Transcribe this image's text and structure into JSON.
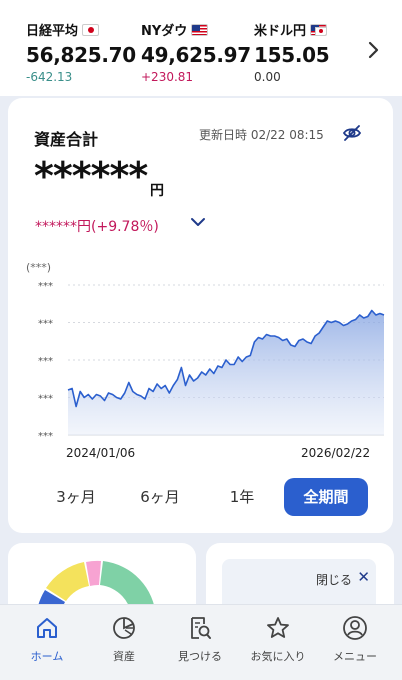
{
  "ticker": [
    {
      "name": "日経平均",
      "value": "56,825.70",
      "change": "-642.13",
      "change_color": "#3a8f8a",
      "flag": "jp"
    },
    {
      "name": "NYダウ",
      "value": "49,625.97",
      "change": "+230.81",
      "change_color": "#c2185b",
      "flag": "us"
    },
    {
      "name": "米ドル円",
      "value": "155.05",
      "change": "0.00",
      "change_color": "#333333",
      "flag": "usjp"
    }
  ],
  "assets": {
    "title": "資産合計",
    "updated": "更新日時 02/22 08:15",
    "total_masked": "******",
    "total_unit": "円",
    "pnl": "******円(+9.78％)",
    "pnl_color": "#c2185b"
  },
  "chart": {
    "unit_label": "(***)",
    "tick_labels": [
      "***",
      "***",
      "***",
      "***",
      "***"
    ],
    "date_start": "2024/01/06",
    "date_end": "2026/02/22",
    "line_color": "#2b5fce"
  },
  "chart_data": {
    "type": "area",
    "x_range": [
      "2024/01/06",
      "2026/02/22"
    ],
    "y_hidden": true,
    "series": [
      {
        "values": [
          0.3,
          0.31,
          0.19,
          0.29,
          0.25,
          0.27,
          0.24,
          0.27,
          0.26,
          0.23,
          0.28,
          0.27,
          0.25,
          0.24,
          0.28,
          0.35,
          0.29,
          0.27,
          0.26,
          0.24,
          0.31,
          0.29,
          0.34,
          0.31,
          0.33,
          0.28,
          0.33,
          0.37,
          0.45,
          0.33,
          0.4,
          0.36,
          0.38,
          0.42,
          0.4,
          0.44,
          0.41,
          0.46,
          0.45,
          0.5,
          0.47,
          0.47,
          0.52,
          0.49,
          0.52,
          0.53,
          0.62,
          0.65,
          0.64,
          0.67,
          0.66,
          0.66,
          0.65,
          0.63,
          0.64,
          0.6,
          0.59,
          0.63,
          0.64,
          0.62,
          0.61,
          0.66,
          0.68,
          0.72,
          0.76,
          0.75,
          0.76,
          0.75,
          0.73,
          0.74,
          0.76,
          0.77,
          0.8,
          0.78,
          0.79,
          0.83,
          0.8,
          0.81,
          0.8
        ]
      }
    ]
  },
  "periods": [
    {
      "label": "3ヶ月",
      "active": false
    },
    {
      "label": "6ヶ月",
      "active": false
    },
    {
      "label": "1年",
      "active": false
    },
    {
      "label": "全期間",
      "active": true
    }
  ],
  "promo": {
    "close_label": "閉じる"
  },
  "nav": [
    {
      "label": "ホーム",
      "icon": "home-icon",
      "active": true
    },
    {
      "label": "資産",
      "icon": "pie-chart-icon",
      "active": false
    },
    {
      "label": "見つける",
      "icon": "search-document-icon",
      "active": false
    },
    {
      "label": "お気に入り",
      "icon": "star-icon",
      "active": false
    },
    {
      "label": "メニュー",
      "icon": "user-icon",
      "active": false
    }
  ]
}
